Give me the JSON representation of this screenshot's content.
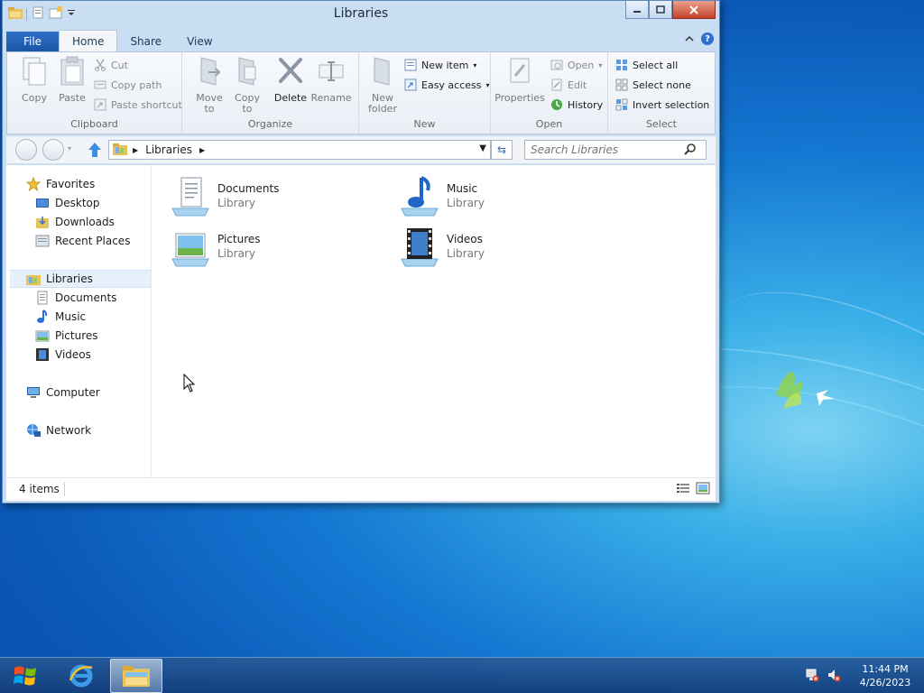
{
  "window": {
    "title": "Libraries"
  },
  "ribbon_tabs": {
    "file": "File",
    "home": "Home",
    "share": "Share",
    "view": "View"
  },
  "ribbon": {
    "clipboard": {
      "label": "Clipboard",
      "copy": "Copy",
      "paste": "Paste",
      "cut": "Cut",
      "copy_path": "Copy path",
      "paste_shortcut": "Paste shortcut"
    },
    "organize": {
      "label": "Organize",
      "move_to": "Move to",
      "copy_to": "Copy to",
      "delete": "Delete",
      "rename": "Rename"
    },
    "new": {
      "label": "New",
      "new_folder": "New folder",
      "new_item": "New item",
      "easy_access": "Easy access"
    },
    "open": {
      "label": "Open",
      "properties": "Properties",
      "open": "Open",
      "edit": "Edit",
      "history": "History"
    },
    "select": {
      "label": "Select",
      "select_all": "Select all",
      "select_none": "Select none",
      "invert_selection": "Invert selection"
    }
  },
  "address": {
    "path": "Libraries",
    "search_placeholder": "Search Libraries"
  },
  "nav_pane": {
    "favorites": "Favorites",
    "favorites_items": [
      "Desktop",
      "Downloads",
      "Recent Places"
    ],
    "libraries": "Libraries",
    "libraries_items": [
      "Documents",
      "Music",
      "Pictures",
      "Videos"
    ],
    "computer": "Computer",
    "network": "Network"
  },
  "content": {
    "items": [
      {
        "name": "Documents",
        "type": "Library"
      },
      {
        "name": "Music",
        "type": "Library"
      },
      {
        "name": "Pictures",
        "type": "Library"
      },
      {
        "name": "Videos",
        "type": "Library"
      }
    ]
  },
  "status": {
    "item_count": "4 items"
  },
  "taskbar": {
    "time": "11:44 PM",
    "date": "4/26/2023"
  },
  "colors": {
    "accent": "#1b55a6",
    "desktop": "#1478d2"
  }
}
